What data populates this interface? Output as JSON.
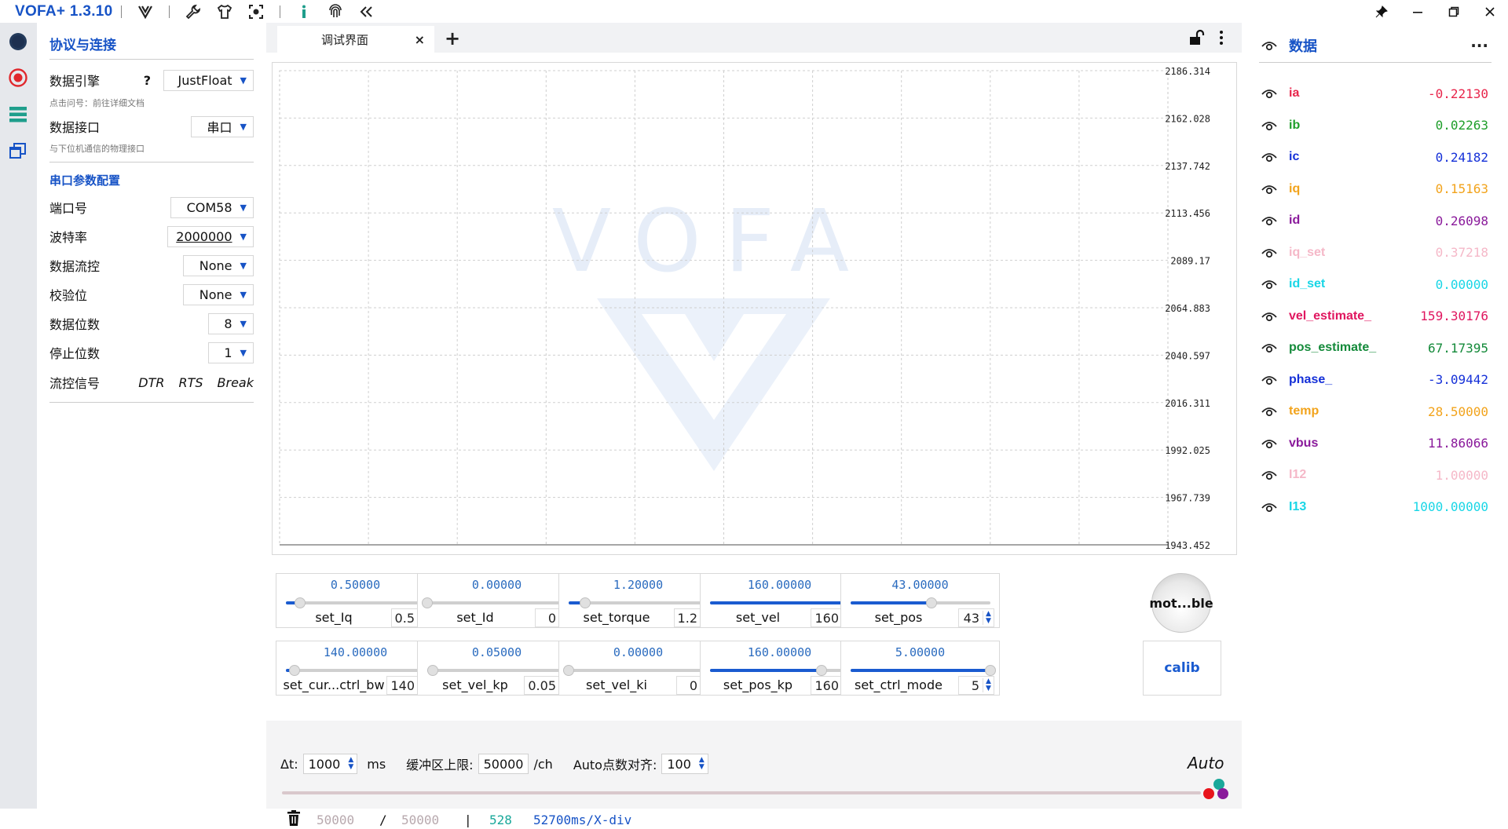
{
  "app": {
    "title": "VOFA+ 1.3.10"
  },
  "titlebar": {
    "icons": [
      "vofa-logo-icon",
      "wrench-icon",
      "shirt-icon",
      "screenshot-icon",
      "info-icon",
      "fingerprint-icon",
      "collapse-icon"
    ],
    "window_buttons": [
      "pin-icon",
      "minimize-icon",
      "maximize-icon",
      "close-icon"
    ]
  },
  "rail": {
    "items": [
      "connection-icon",
      "record-icon",
      "list-icon",
      "windows-icon"
    ],
    "colors": {
      "active": "#e0282d",
      "accent": "#1f9e8c",
      "dark": "#233a5b",
      "blue": "#1753c6"
    }
  },
  "settings": {
    "title": "协议与连接",
    "engine_label": "数据引擎",
    "engine_help": "?",
    "engine_value": "JustFloat",
    "engine_hint": "点击问号：前往详细文档",
    "interface_label": "数据接口",
    "interface_value": "串口",
    "interface_hint": "与下位机通信的物理接口",
    "serial_title": "串口参数配置",
    "port_label": "端口号",
    "port_value": "COM58",
    "baud_label": "波特率",
    "baud_value": "2000000",
    "flow_label": "数据流控",
    "flow_value": "None",
    "parity_label": "校验位",
    "parity_value": "None",
    "databits_label": "数据位数",
    "databits_value": "8",
    "stopbits_label": "停止位数",
    "stopbits_value": "1",
    "signal_label": "流控信号",
    "signals": [
      "DTR",
      "RTS",
      "Break"
    ]
  },
  "tabs": {
    "active_label": "调试界面",
    "close": "×",
    "add": "+"
  },
  "plot": {
    "watermark": "VOFA",
    "y_ticks": [
      "2186.314",
      "2162.028",
      "2137.742",
      "2113.456",
      "2089.17",
      "2064.883",
      "2040.597",
      "2016.311",
      "1992.025",
      "1967.739",
      "1943.452"
    ],
    "v_gridlines": 10,
    "h_gridlines": 10
  },
  "sliders": [
    {
      "value_text": "0.50000",
      "name": "set_Iq",
      "spin": "0.5",
      "fraction": 0.1
    },
    {
      "value_text": "0.00000",
      "name": "set_Id",
      "spin": "0",
      "fraction": 0.0
    },
    {
      "value_text": "1.20000",
      "name": "set_torque",
      "spin": "1.2",
      "fraction": 0.12
    },
    {
      "value_text": "160.00000",
      "name": "set_vel",
      "spin": "160",
      "fraction": 1.0
    },
    {
      "value_text": "43.00000",
      "name": "set_pos",
      "spin": "43",
      "fraction": 0.58
    },
    {
      "value_text": "140.00000",
      "name": "set_cur...ctrl_bw",
      "spin": "140",
      "fraction": 0.06
    },
    {
      "value_text": "0.05000",
      "name": "set_vel_kp",
      "spin": "0.05",
      "fraction": 0.04
    },
    {
      "value_text": "0.00000",
      "name": "set_vel_ki",
      "spin": "0",
      "fraction": 0.0
    },
    {
      "value_text": "160.00000",
      "name": "set_pos_kp",
      "spin": "160",
      "fraction": 0.8
    },
    {
      "value_text": "5.00000",
      "name": "set_ctrl_mode",
      "spin": "5",
      "fraction": 1.0
    }
  ],
  "buttons": {
    "motor": "mot...ble",
    "calib": "calib"
  },
  "bottom": {
    "dt_label": "Δt:",
    "dt_value": "1000",
    "dt_unit": "ms",
    "buffer_label": "缓冲区上限:",
    "buffer_value": "50000",
    "buffer_unit": "/ch",
    "auto_align_label": "Auto点数对齐:",
    "auto_align_value": "100",
    "auto_label": "Auto",
    "stats": {
      "a": "50000",
      "slash": "/",
      "b": "50000",
      "bar": "|",
      "count": "528",
      "xdiv": "52700ms/X-div"
    }
  },
  "data_panel": {
    "title": "数据",
    "more": "···",
    "channels": [
      {
        "name": "ia",
        "value": "-0.22130",
        "color": "#e8254b"
      },
      {
        "name": "ib",
        "value": "0.02263",
        "color": "#1e9e2a"
      },
      {
        "name": "ic",
        "value": "0.24182",
        "color": "#1530d8"
      },
      {
        "name": "iq",
        "value": "0.15163",
        "color": "#f2a31b"
      },
      {
        "name": "id",
        "value": "0.26098",
        "color": "#8a1a9b"
      },
      {
        "name": "iq_set",
        "value": "0.37218",
        "color": "#f5b8c8"
      },
      {
        "name": "id_set",
        "value": "0.00000",
        "color": "#19d6e6"
      },
      {
        "name": "vel_estimate_",
        "value": "159.30176",
        "color": "#e0165f"
      },
      {
        "name": "pos_estimate_",
        "value": "67.17395",
        "color": "#148a3a"
      },
      {
        "name": "phase_",
        "value": "-3.09442",
        "color": "#1530d8"
      },
      {
        "name": "temp",
        "value": "28.50000",
        "color": "#f2a31b"
      },
      {
        "name": "vbus",
        "value": "11.86066",
        "color": "#8a1a9b"
      },
      {
        "name": "I12",
        "value": "1.00000",
        "color": "#f5b8c8"
      },
      {
        "name": "I13",
        "value": "1000.00000",
        "color": "#19d6e6"
      }
    ]
  }
}
